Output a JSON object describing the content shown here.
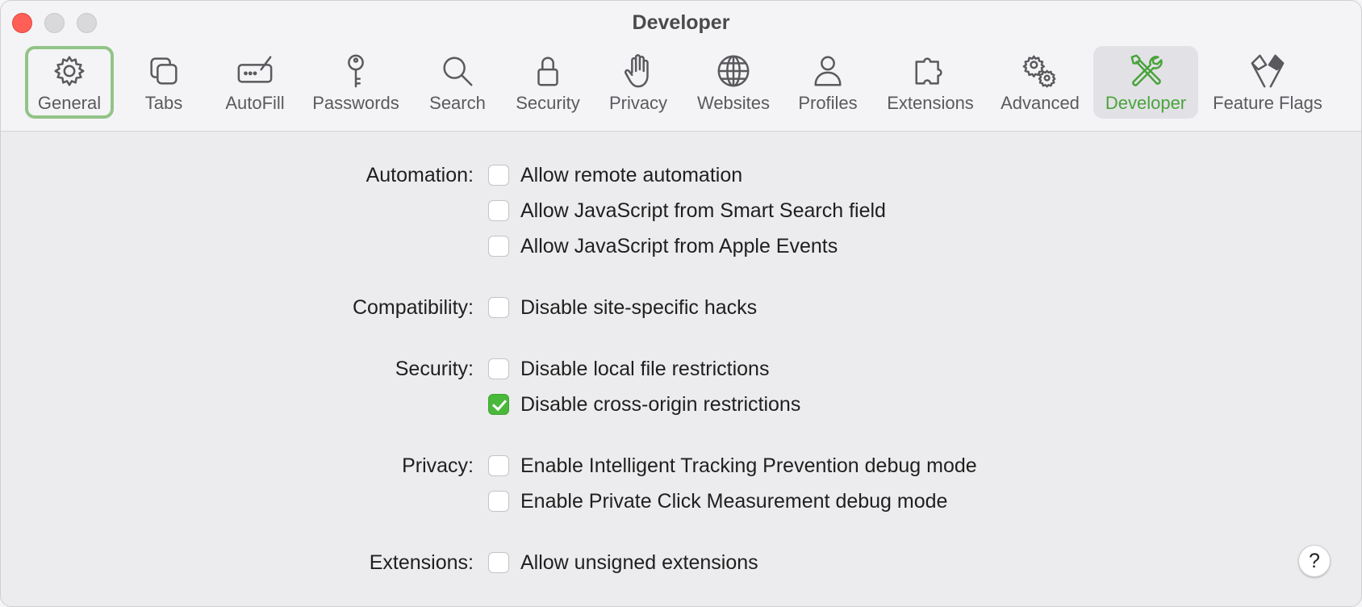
{
  "window": {
    "title": "Developer"
  },
  "toolbar": {
    "items": [
      {
        "label": "General",
        "icon": "gear-icon"
      },
      {
        "label": "Tabs",
        "icon": "tabs-icon"
      },
      {
        "label": "AutoFill",
        "icon": "autofill-icon"
      },
      {
        "label": "Passwords",
        "icon": "key-icon"
      },
      {
        "label": "Search",
        "icon": "magnifier-icon"
      },
      {
        "label": "Security",
        "icon": "lock-icon"
      },
      {
        "label": "Privacy",
        "icon": "hand-icon"
      },
      {
        "label": "Websites",
        "icon": "globe-icon"
      },
      {
        "label": "Profiles",
        "icon": "person-icon"
      },
      {
        "label": "Extensions",
        "icon": "puzzle-icon"
      },
      {
        "label": "Advanced",
        "icon": "gears-icon"
      },
      {
        "label": "Developer",
        "icon": "wrench-screwdriver-icon"
      },
      {
        "label": "Feature Flags",
        "icon": "flags-icon"
      }
    ],
    "selected": "Developer",
    "accent_color": "#4aa33c",
    "highlight_color": "#92c487"
  },
  "sections": {
    "automation": {
      "label": "Automation:",
      "options": [
        {
          "text": "Allow remote automation",
          "checked": false
        },
        {
          "text": "Allow JavaScript from Smart Search field",
          "checked": false
        },
        {
          "text": "Allow JavaScript from Apple Events",
          "checked": false
        }
      ]
    },
    "compatibility": {
      "label": "Compatibility:",
      "options": [
        {
          "text": "Disable site-specific hacks",
          "checked": false
        }
      ]
    },
    "security": {
      "label": "Security:",
      "options": [
        {
          "text": "Disable local file restrictions",
          "checked": false
        },
        {
          "text": "Disable cross-origin restrictions",
          "checked": true
        }
      ]
    },
    "privacy": {
      "label": "Privacy:",
      "options": [
        {
          "text": "Enable Intelligent Tracking Prevention debug mode",
          "checked": false
        },
        {
          "text": "Enable Private Click Measurement debug mode",
          "checked": false
        }
      ]
    },
    "extensions": {
      "label": "Extensions:",
      "options": [
        {
          "text": "Allow unsigned extensions",
          "checked": false
        }
      ]
    }
  },
  "help": {
    "label": "?"
  }
}
